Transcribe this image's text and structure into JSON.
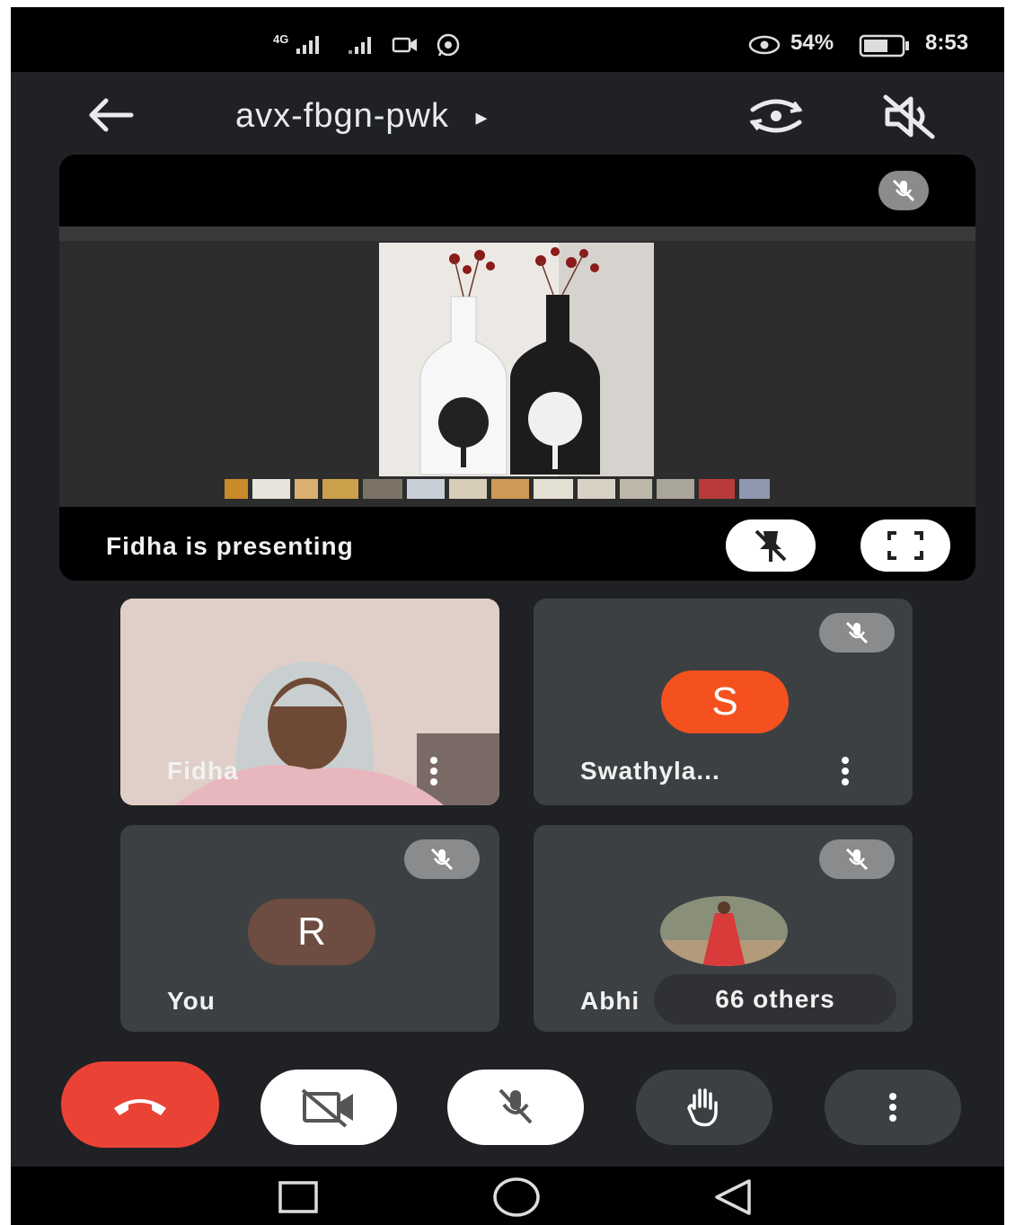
{
  "status_bar": {
    "network": "4G",
    "battery": "54%",
    "time": "8:53"
  },
  "top_bar": {
    "meeting_code": "avx-fbgn-pwk",
    "code_arrow": "▸"
  },
  "presentation": {
    "presenting_label": "Fidha is presenting"
  },
  "participants": [
    {
      "name": "Fidha",
      "type": "video"
    },
    {
      "name": "Swathyla...",
      "initial": "S",
      "avatar_color": "#f4511e"
    },
    {
      "name": "You",
      "initial": "R",
      "avatar_color": "#6d4c41"
    },
    {
      "name": "Abhi",
      "type": "photo"
    }
  ],
  "others_chip": {
    "label": "66 others"
  },
  "icons": [
    "back-arrow-icon",
    "switch-camera-icon",
    "speaker-off-icon",
    "mic-off-icon",
    "unpin-icon",
    "fullscreen-icon",
    "more-vert-icon",
    "end-call-icon",
    "camera-off-icon",
    "raise-hand-icon",
    "recents-icon",
    "home-icon",
    "back-nav-icon"
  ],
  "colors": {
    "end_call": "#ea4335",
    "background": "#202124",
    "tile": "#3c4043"
  }
}
